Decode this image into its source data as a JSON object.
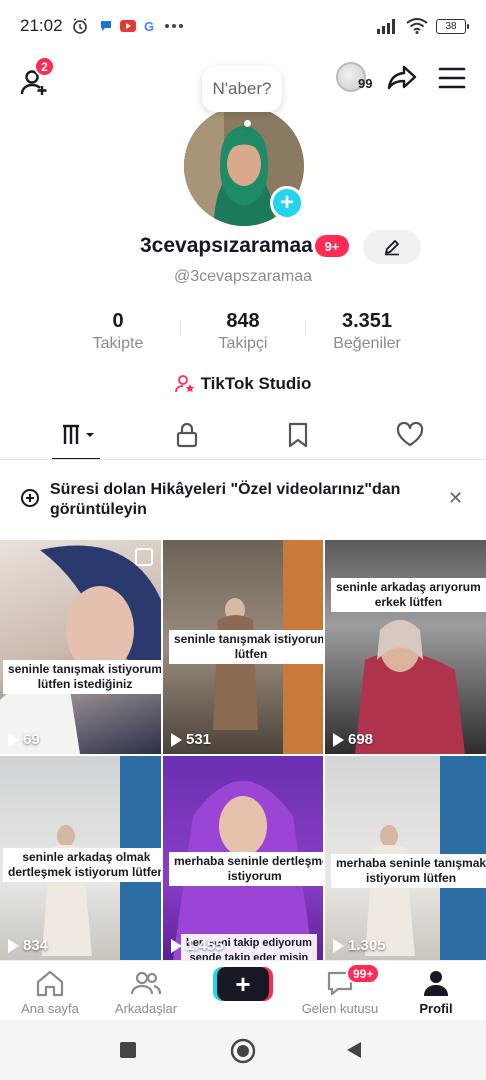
{
  "status_bar": {
    "time": "21:02",
    "battery": "38"
  },
  "header": {
    "friend_requests_badge": "2",
    "coin_count": "99"
  },
  "profile": {
    "bubble_text": "N'aber?",
    "username": "3cevapsızaramaa",
    "username_badge": "9+",
    "handle": "@3cevapszaramaa"
  },
  "stats": [
    {
      "value": "0",
      "label": "Takipte"
    },
    {
      "value": "848",
      "label": "Takipçi"
    },
    {
      "value": "3.351",
      "label": "Beğeniler"
    }
  ],
  "studio_label": "TikTok Studio",
  "tabs": [
    {
      "icon": "videos-grid-icon"
    },
    {
      "icon": "lock-icon"
    },
    {
      "icon": "bookmark-icon"
    },
    {
      "icon": "heart-icon"
    }
  ],
  "notice": {
    "text": "Süresi dolan Hikâyeleri \"Özel videolarınız\"dan görüntüleyin"
  },
  "videos": [
    {
      "caption": [
        "seninle tanışmak istiyorum",
        "lütfen istediğiniz"
      ],
      "views": "69"
    },
    {
      "caption": [
        "seninle tanışmak istiyorum",
        "lütfen"
      ],
      "views": "531"
    },
    {
      "caption": [
        "seninle arkadaş arıyorum",
        "erkek lütfen"
      ],
      "views": "698"
    },
    {
      "caption": [
        "seninle arkadaş olmak",
        "dertleşmek istiyorum lütfen"
      ],
      "views": "834"
    },
    {
      "caption": [
        "merhaba seninle dertleşmek",
        "istiyorum"
      ],
      "views": "1.455",
      "caption2": [
        "ben seni takip ediyorum",
        "sende takip eder misin"
      ]
    },
    {
      "caption": [
        "merhaba seninle tanışmak",
        "istiyorum lütfen"
      ],
      "views": "1.305"
    }
  ],
  "bottom_nav": {
    "home": "Ana sayfa",
    "friends": "Arkadaşlar",
    "inbox": "Gelen kutusu",
    "inbox_badge": "99+",
    "profile": "Profil"
  },
  "colors": {
    "accent_red": "#fe2c55",
    "accent_cyan": "#20d5ec"
  }
}
